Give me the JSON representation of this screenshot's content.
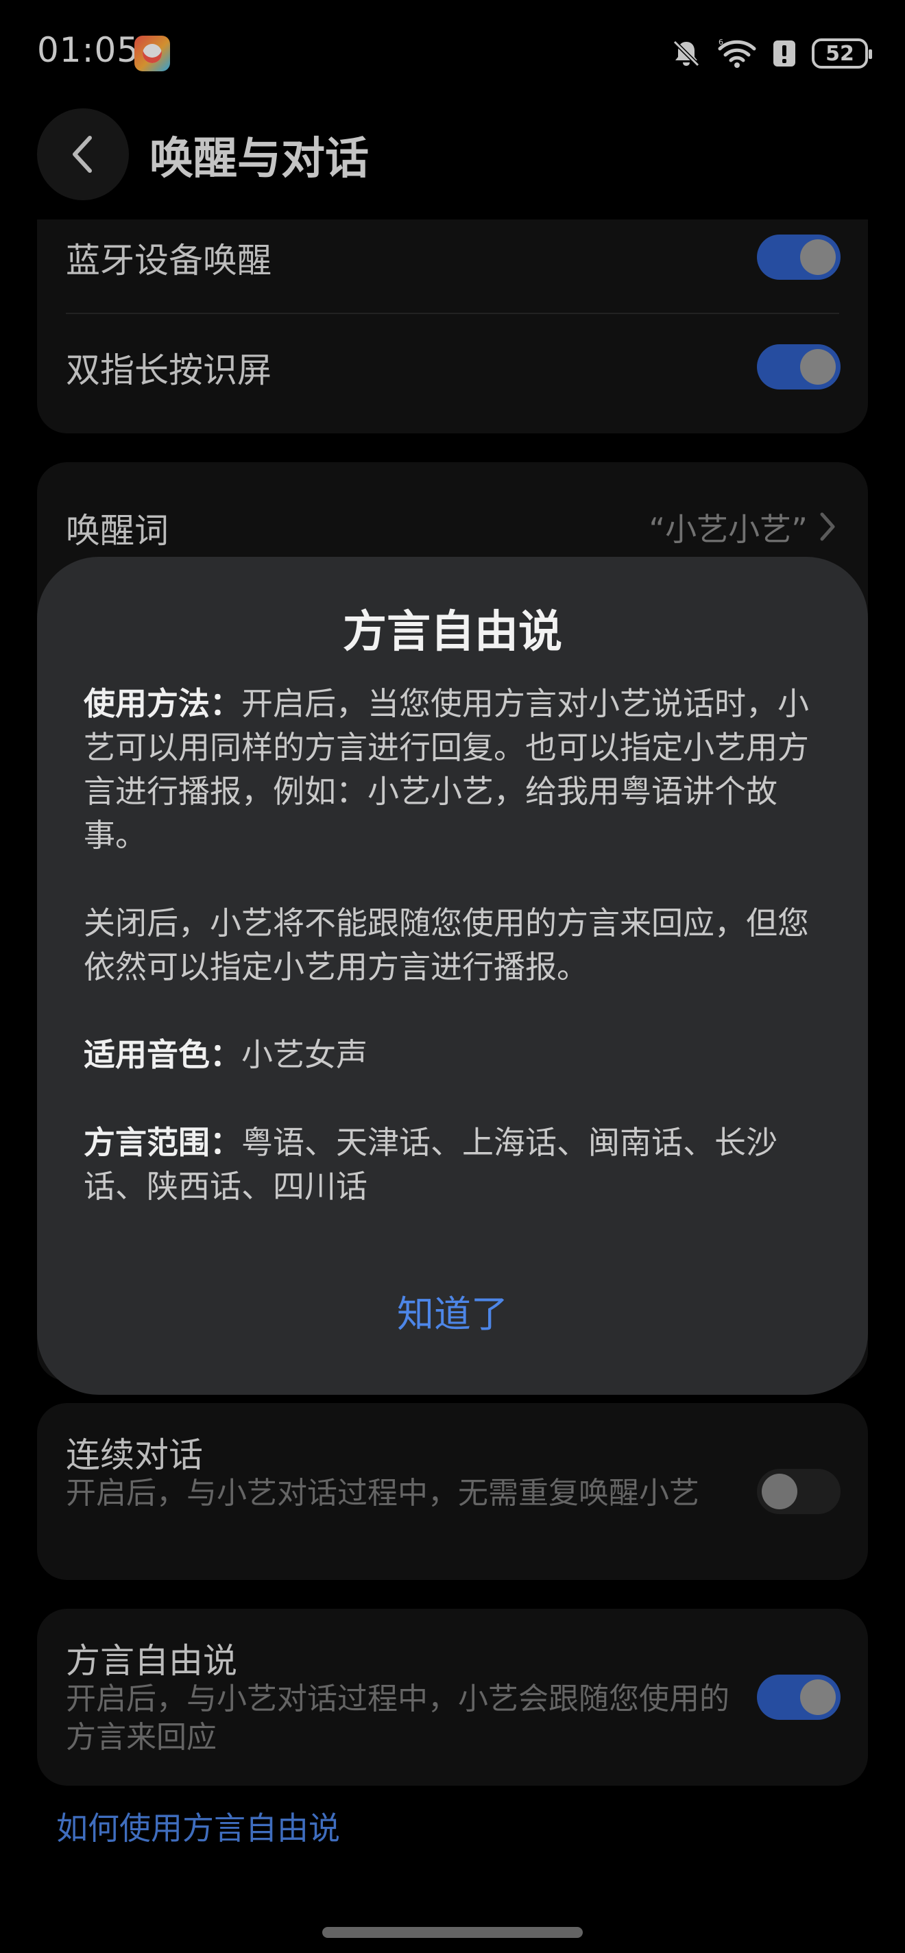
{
  "status_bar": {
    "time": "01:05",
    "battery": "52",
    "icons": [
      "app-badge-icon",
      "mute-bell-icon",
      "wifi-icon",
      "alert-icon",
      "battery-icon"
    ]
  },
  "header": {
    "title": "唤醒与对话",
    "back_icon": "chevron-left-icon"
  },
  "settings_top": {
    "items": [
      {
        "label": "蓝牙设备唤醒",
        "enabled": true
      },
      {
        "label": "双指长按识屏",
        "enabled": true
      }
    ]
  },
  "wake_word": {
    "label": "唤醒词",
    "value": "“小艺小艺”"
  },
  "continuous_dialog": {
    "title": "连续对话",
    "desc": "开启后，与小艺对话过程中，无需重复唤醒小艺",
    "enabled": false
  },
  "dialect": {
    "title": "方言自由说",
    "desc": "开启后，与小艺对话过程中，小艺会跟随您使用的方言来回应",
    "enabled": true
  },
  "help_link": "如何使用方言自由说",
  "dialog": {
    "title": "方言自由说",
    "usage_label": "使用方法：",
    "usage_text": "开启后，当您使用方言对小艺说话时，小艺可以用同样的方言进行回复。也可以指定小艺用方言进行播报，例如：小艺小艺，给我用粤语讲个故事。",
    "off_text": "关闭后，小艺将不能跟随您使用的方言来回应，但您依然可以指定小艺用方言进行播报。",
    "voice_label": "适用音色：",
    "voice_text": "小艺女声",
    "range_label": "方言范围：",
    "range_text": "粤语、天津话、上海话、闽南话、长沙话、陕西话、四川话",
    "ok_button": "知道了"
  },
  "colors": {
    "accent": "#4d86e8",
    "toggle_on": "#2f5ec4",
    "dialog_bg": "#2b2c2e",
    "card_bg": "#141414"
  }
}
